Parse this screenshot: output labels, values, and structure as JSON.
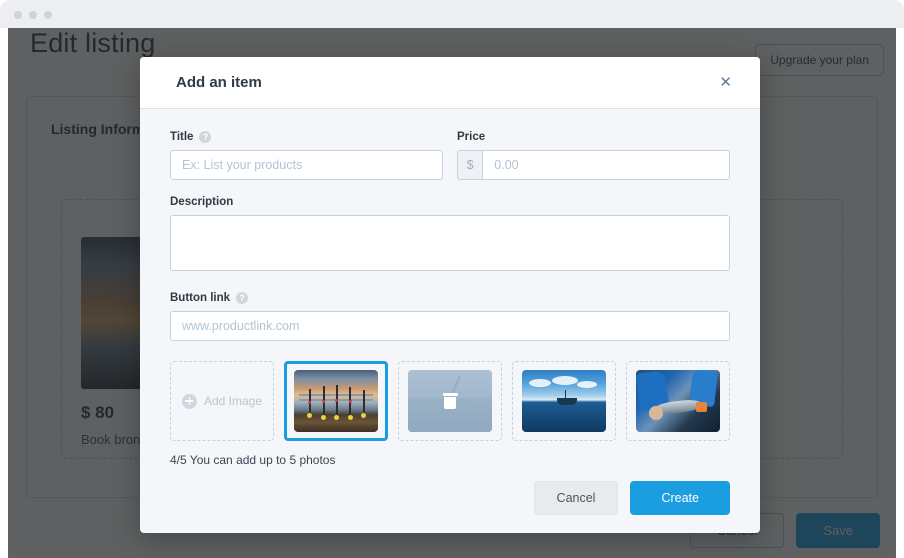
{
  "window": {
    "traffic_lights": 3
  },
  "background_page": {
    "title": "Edit listing",
    "upgrade_button": "Upgrade your plan",
    "section_title": "Listing Information",
    "product": {
      "price": "$ 80",
      "description": "Book bron"
    },
    "footer": {
      "cancel_label": "Cancel",
      "save_label": "Save"
    }
  },
  "modal": {
    "title": "Add an item",
    "close_icon": "close-icon",
    "fields": {
      "title": {
        "label": "Title",
        "help_icon": "help-icon",
        "value": "",
        "placeholder": "Ex: List your products"
      },
      "price": {
        "label": "Price",
        "currency_prefix": "$",
        "value": "",
        "placeholder": "0.00"
      },
      "description": {
        "label": "Description",
        "value": "",
        "placeholder": ""
      },
      "button_link": {
        "label": "Button link",
        "help_icon": "help-icon",
        "value": "",
        "placeholder": "www.productlink.com"
      }
    },
    "photos": {
      "add_label": "Add Image",
      "add_icon": "plus-circle-icon",
      "counter_text": "4/5 You can add up to 5 photos",
      "items": [
        {
          "name": "pier-fishing-rods",
          "selected": true,
          "overlay": "none"
        },
        {
          "name": "boat-rod-hover",
          "selected": false,
          "overlay": "trash"
        },
        {
          "name": "boat-on-sea",
          "selected": false,
          "overlay": "none"
        },
        {
          "name": "angler-holding-fish",
          "selected": false,
          "overlay": "none"
        }
      ]
    },
    "footer": {
      "cancel_label": "Cancel",
      "create_label": "Create"
    }
  },
  "colors": {
    "accent_blue": "#1a9ee0",
    "modal_bg": "#f4f6f9",
    "scrim": "rgba(32,34,36,0.72)",
    "input_border": "#c3d2e0"
  }
}
